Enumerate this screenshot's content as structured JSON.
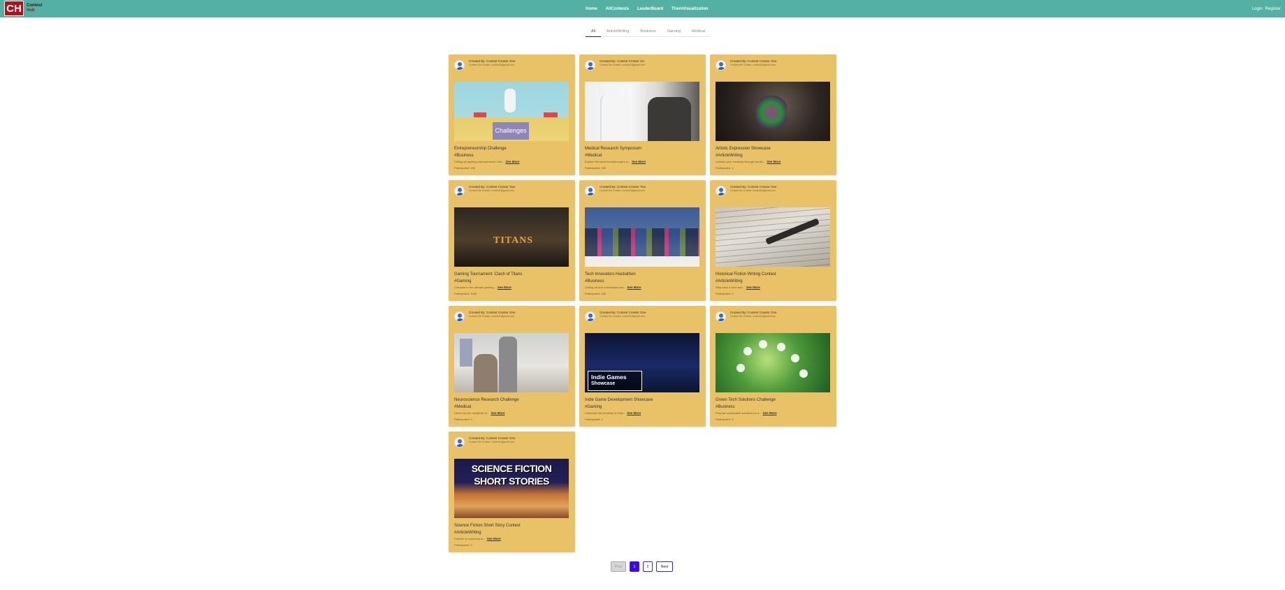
{
  "brand": {
    "logo": "CH",
    "line1": "Contest",
    "line2": "Hub"
  },
  "nav": {
    "links": [
      "Home",
      "AllContests",
      "LeaderBoard",
      "ThemVisualization"
    ],
    "login": "Login",
    "register": "Register"
  },
  "tabs": [
    "All",
    "ArticleWriting",
    "Business",
    "Gaming",
    "Medical"
  ],
  "active_tab": "All",
  "cards": [
    {
      "creator": "Created By: Contest Creator One",
      "contact": "Contact the Creator: contest1@gmail.com",
      "image": "challenges-illustration",
      "image_text": "Challenges",
      "title": "Entrepreneurship Challenge",
      "tag": "#Business",
      "desc": "Calling all aspiring entrepreneurs! Join...",
      "see_more": "See More",
      "participated": "Participated: 450"
    },
    {
      "creator": "Created By: Contest Creator On",
      "contact": "Contact the Creator: contest1@gmail.com",
      "image": "lab-discussion-photo",
      "title": "Medical Research Symposium",
      "tag": "#Medical",
      "desc": "Explore the latest breakthroughs in...",
      "see_more": "See More",
      "participated": "Participated: 335"
    },
    {
      "creator": "Created By: Contest Creator One",
      "contact": "Contact the Creator: contest1@gmail.com",
      "image": "painted-hand-photo",
      "title": "Artistic Expression Showcase",
      "tag": "#ArticleWriting",
      "desc": "Unleash your creativity through words!...",
      "see_more": "See More",
      "participated": "Participated: 1"
    },
    {
      "creator": "Created By: Contest Creator Two",
      "contact": "Contact the Creator: contest2@gmail.com",
      "image": "clash-of-titans-artwork",
      "image_text": "TITANS",
      "title": "Gaming Tournament: Clash of Titans",
      "tag": "#Gaming",
      "desc": "Compete in the ultimate gaming...",
      "see_more": "See More",
      "participated": "Participated: 1000"
    },
    {
      "creator": "Created By: Contest Creator Two",
      "contact": "Contact the Creator: contest2@gmail.com",
      "image": "hackathon-team-photo",
      "title": "Tech Innovators Hackathon",
      "tag": "#Business",
      "desc": "Calling all tech enthusiasts and...",
      "see_more": "See More",
      "participated": "Participated: 180"
    },
    {
      "creator": "Created By: Contest Creator One",
      "contact": "Contact the Creator: contest1@gmail.com",
      "image": "fountain-pen-photo",
      "title": "Historical Fiction Writing Contest",
      "tag": "#ArticleWriting",
      "desc": "Step back in time and...",
      "see_more": "See More",
      "participated": "Participated: 0"
    },
    {
      "creator": "Created By: Contest Creator One",
      "contact": "Contact the Creator: contest1@gmail.com",
      "image": "clinic-photo",
      "title": "Neuroscience Research Challenge",
      "tag": "#Medical",
      "desc": "Delve into the mysteries of...",
      "see_more": "See More",
      "participated": "Participated: 0"
    },
    {
      "creator": "Created By: Contest Creator One",
      "contact": "Contact the Creator: contest1@gmail.com",
      "image": "indie-games-artwork",
      "image_text": "Indie Games",
      "image_subtext": "Showcase",
      "title": "Indie Game Development Showcase",
      "tag": "#Gaming",
      "desc": "Celebrate the creativity of indie...",
      "see_more": "See More",
      "participated": "Participated: 1"
    },
    {
      "creator": "Created By: Contest Creator One",
      "contact": "Contact the Creator: contest1@gmail.com",
      "image": "green-tech-icons-photo",
      "title": "Green Tech Solutions Challenge",
      "tag": "#Business",
      "desc": "Propose sustainable solutions for a...",
      "see_more": "See More",
      "participated": "Participated: 0"
    },
    {
      "creator": "Created By: Contest Creator One",
      "contact": "Contact the Creator: contest1@gmail.com",
      "image": "science-fiction-artwork",
      "image_text": "SCIENCE FICTION",
      "image_subtext": "SHORT STORIES",
      "title": "Science Fiction Short Story Contest",
      "tag": "#ArticleWriting",
      "desc": "Embark on a journey to...",
      "see_more": "See More",
      "participated": "Participated: 0"
    }
  ],
  "pagination": {
    "prev": "Prev",
    "pages": [
      "1",
      "2"
    ],
    "current": "1",
    "next": "Next"
  }
}
